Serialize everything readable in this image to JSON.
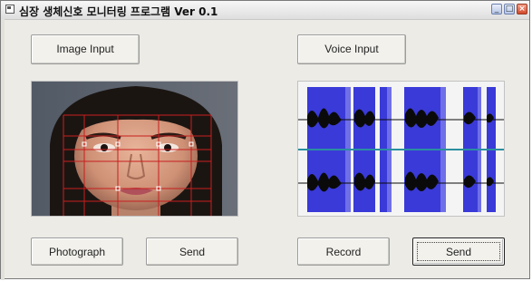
{
  "window": {
    "title": "심장 생체신호 모니터링 프로그램 Ver 0.1",
    "min_glyph": "_",
    "max_glyph": "□",
    "close_glyph": "×"
  },
  "buttons": {
    "image_input": "Image Input",
    "voice_input": "Voice Input",
    "photograph": "Photograph",
    "send_image": "Send",
    "record": "Record",
    "send_voice": "Send"
  },
  "colors": {
    "grid": "#c81e1e",
    "wave_bg": "#3a3ad8",
    "wave": "#0a0a0a",
    "baseline": "#2a8fa0"
  },
  "icons": {
    "app": "window-app-icon",
    "minimize": "minimize-icon",
    "maximize": "maximize-icon",
    "close": "close-icon"
  }
}
